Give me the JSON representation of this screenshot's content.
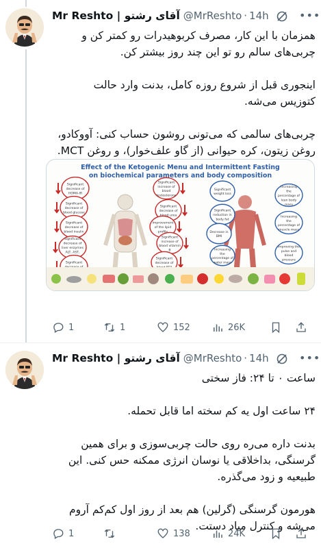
{
  "tweets": [
    {
      "name": "Mr Reshto | آقای رشتو",
      "handle": "@MrReshto",
      "time": "14h",
      "text": "همزمان با این کار، مصرف کربوهیدرات رو کمتر کن و\nچربی‌های سالم رو تو این چند روز بیشتر کن.\n\nاینجوری قبل از شروع روزه کامل، بدنت وارد حالت\nکتوزیس می‌شه.\n\nچربی‌های سالمی که می‌تونی روشون حساب کنی: آووکادو،\nروغن زیتون، کره حیوانی (از گاو علف‌خوار)، و روغن MCT.",
      "media": {
        "title_line1": "Effect of the Ketogenic Menu and Intermittent Fasting",
        "title_line2": "on biochemical parameters and body composition",
        "left_labels": [
          "Significant decrease of HOMA-IR",
          "Significant decrease of blood glucose",
          "Significant decrease of blood insulin",
          "Significant decrease of liver enzymes ALT, AST, GGTP",
          "Significant decrease of blood iron"
        ],
        "mid_labels": [
          "Significant increase of blood testosterone",
          "Significant decrease of blood urea",
          "Improvement of the lipid profile",
          "Significant increase of blood vitamin B",
          "Significant decrease of blood FT3"
        ],
        "right_labels": [
          "Significant weight loss",
          "Significant reduction in body fat",
          "Decrease in BMI",
          "Increasing the percentage of water mass"
        ],
        "far_right_labels": [
          "Increasing the percentage of lean body mass",
          "Increasing the percentage of muscle mass",
          "Improving the pulse and blood pressure"
        ]
      },
      "actions": {
        "replies": "1",
        "retweets": "1",
        "likes": "152",
        "views": "26K"
      }
    },
    {
      "name": "Mr Reshto | آقای رشتو",
      "handle": "@MrReshto",
      "time": "14h",
      "text": "ساعت ۰ تا ۲۴: فاز سختی\n\n۲۴ ساعت اول یه کم سخته اما قابل تحمله.\n\nبدنت داره می‌ره روی حالت چربی‌سوزی و برای همین\nگرسنگی، بداخلاقی یا نوسان انرژی ممکنه حس کنی. این\nطبیعیه و زود می‌گذره.\n\nهورمون گرسنگی (گرلین) هم بعد از روز اول کم‌کم آروم\nمی‌شه و کنترل میاد دستت.",
      "actions": {
        "replies": "1",
        "retweets": "",
        "likes": "138",
        "views": "24K"
      }
    }
  ],
  "colors": {
    "text": "#0f1419",
    "muted": "#536471",
    "border": "#cfd9de",
    "arrow_red": "#c62828",
    "title_blue": "#2f5fa8"
  }
}
